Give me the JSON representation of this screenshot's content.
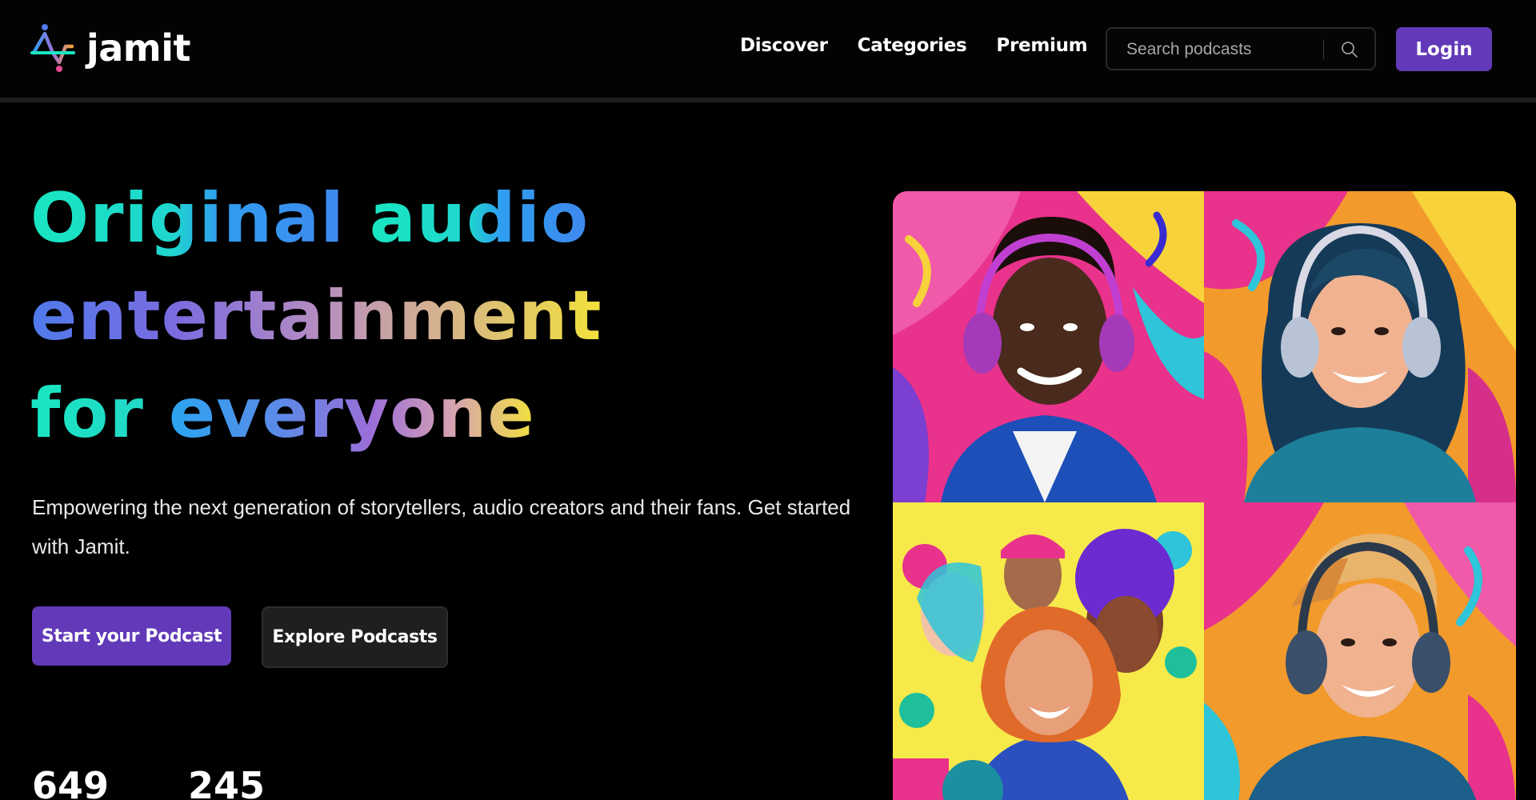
{
  "brand": {
    "name": "jamit",
    "logo_icon": "jamit-waveform-logo-icon"
  },
  "nav": {
    "items": [
      {
        "label": "Discover"
      },
      {
        "label": "Categories"
      },
      {
        "label": "Premium"
      }
    ]
  },
  "search": {
    "placeholder": "Search podcasts",
    "icon": "search-icon"
  },
  "header": {
    "login_label": "Login"
  },
  "hero": {
    "title_line1_a": "Original",
    "title_line1_b": "audio",
    "title_line2": "entertainment",
    "title_line3_a": "for",
    "title_line3_b": "everyone",
    "description": "Empowering the next generation of storytellers, audio creators and their fans. Get started with Jamit.",
    "primary_cta": "Start your Podcast",
    "secondary_cta": "Explore Podcasts"
  },
  "stats": [
    {
      "value": "649"
    },
    {
      "value": "245"
    }
  ],
  "gallery": {
    "images": [
      {
        "name": "listener-portrait-1"
      },
      {
        "name": "listener-portrait-2"
      },
      {
        "name": "group-of-fans"
      },
      {
        "name": "listener-portrait-3"
      }
    ]
  },
  "colors": {
    "accent": "#6239b8",
    "background": "#000000",
    "gradient_teal": "#19e6c1",
    "gradient_blue": "#3f88ee",
    "gradient_purple": "#7b6be0",
    "gradient_yellow": "#f2e13b"
  }
}
